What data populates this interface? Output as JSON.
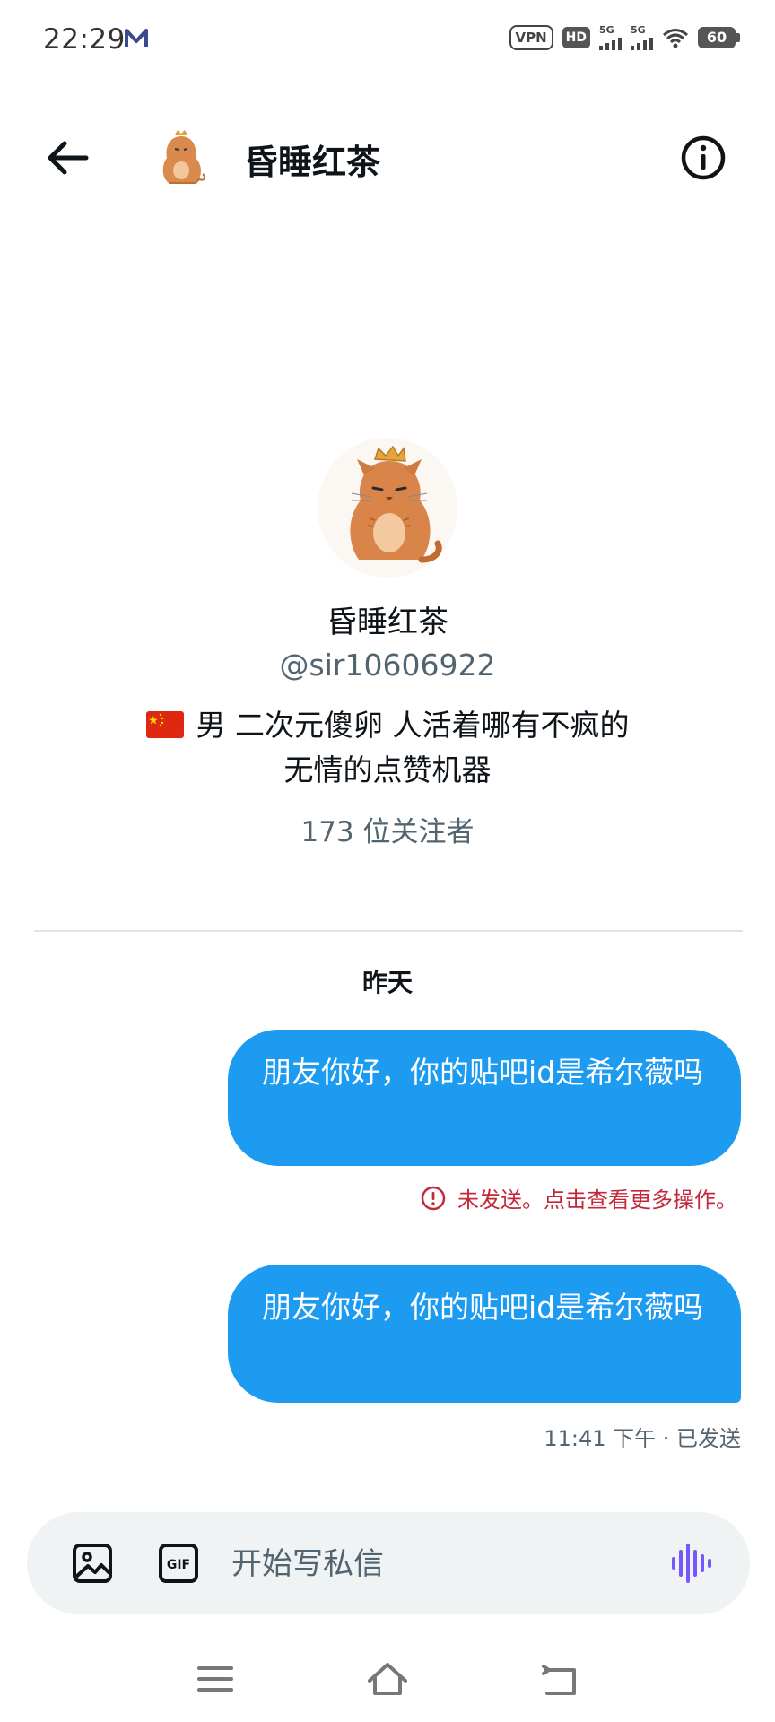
{
  "status_bar": {
    "time": "22:29",
    "vpn": "VPN",
    "hd": "HD",
    "network_1": "5G",
    "network_2": "5G",
    "battery": "60"
  },
  "header": {
    "title": "昏睡红茶"
  },
  "profile": {
    "name": "昏睡红茶",
    "handle": "@sir10606922",
    "bio_line_1": "男 二次元傻卵 人活着哪有不疯的",
    "bio_line_2": "无情的点赞机器",
    "followers": "173 位关注者"
  },
  "conversation": {
    "day_label": "昨天",
    "messages": [
      {
        "text": "朋友你好，你的贴吧id是希尔薇吗",
        "status": "未发送。点击查看更多操作。"
      },
      {
        "text": "朋友你好，你的贴吧id是希尔薇吗",
        "status": "11:41 下午 · 已发送"
      }
    ]
  },
  "composer": {
    "placeholder": "开始写私信"
  },
  "colors": {
    "bubble": "#1d9bf0",
    "error": "#c4273a",
    "voice_accent": "#7856ff"
  }
}
